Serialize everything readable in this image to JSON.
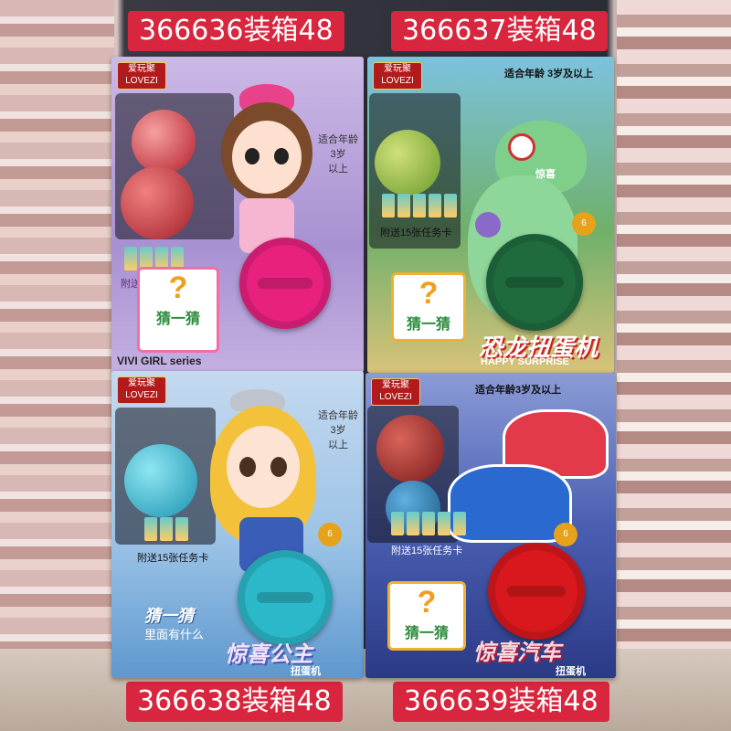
{
  "labels": {
    "top_left": "366636装箱48",
    "top_right": "366637装箱48",
    "bottom_left": "366638装箱48",
    "bottom_right": "366639装箱48"
  },
  "boxes": {
    "doll": {
      "brand": "爱玩聚\nLOVEZI",
      "age": "适合年龄\n3岁\n以上",
      "series": "VIVI GIRL series",
      "guess": "猜一猜",
      "cards_text": "附送15张任务卡",
      "knob_color": "#e8217f",
      "bg_color": "#b7a4d8"
    },
    "dino": {
      "brand": "爱玩聚\nLOVEZI",
      "age": "适合年龄 3岁及以上",
      "title": "恐龙扭蛋机",
      "subtitle": "HAPPY SURPRISE",
      "guess": "猜一猜",
      "cards_text": "附送15张任务卡",
      "surprise": "惊喜",
      "knob_color": "#1f6b3f",
      "bg_color": "#4fa3c6"
    },
    "princess": {
      "brand": "爱玩聚\nLOVEZI",
      "age": "适合年龄\n3岁\n以上",
      "title": "惊喜公主",
      "subtitle": "扭蛋机",
      "guess": "猜一猜",
      "guess_sub": "里面有什么",
      "cards_text": "附送15张任务卡",
      "knob_color": "#2bb8c9",
      "bg_color": "#9fc6e8"
    },
    "car": {
      "brand": "爱玩聚\nLOVEZI",
      "age": "适合年龄3岁及以上",
      "title": "惊喜汽车",
      "subtitle": "扭蛋机",
      "guess": "猜一猜",
      "cards_text": "附送15张任务卡",
      "knob_color": "#d8181d",
      "bg_color": "#3d4f9e"
    }
  }
}
